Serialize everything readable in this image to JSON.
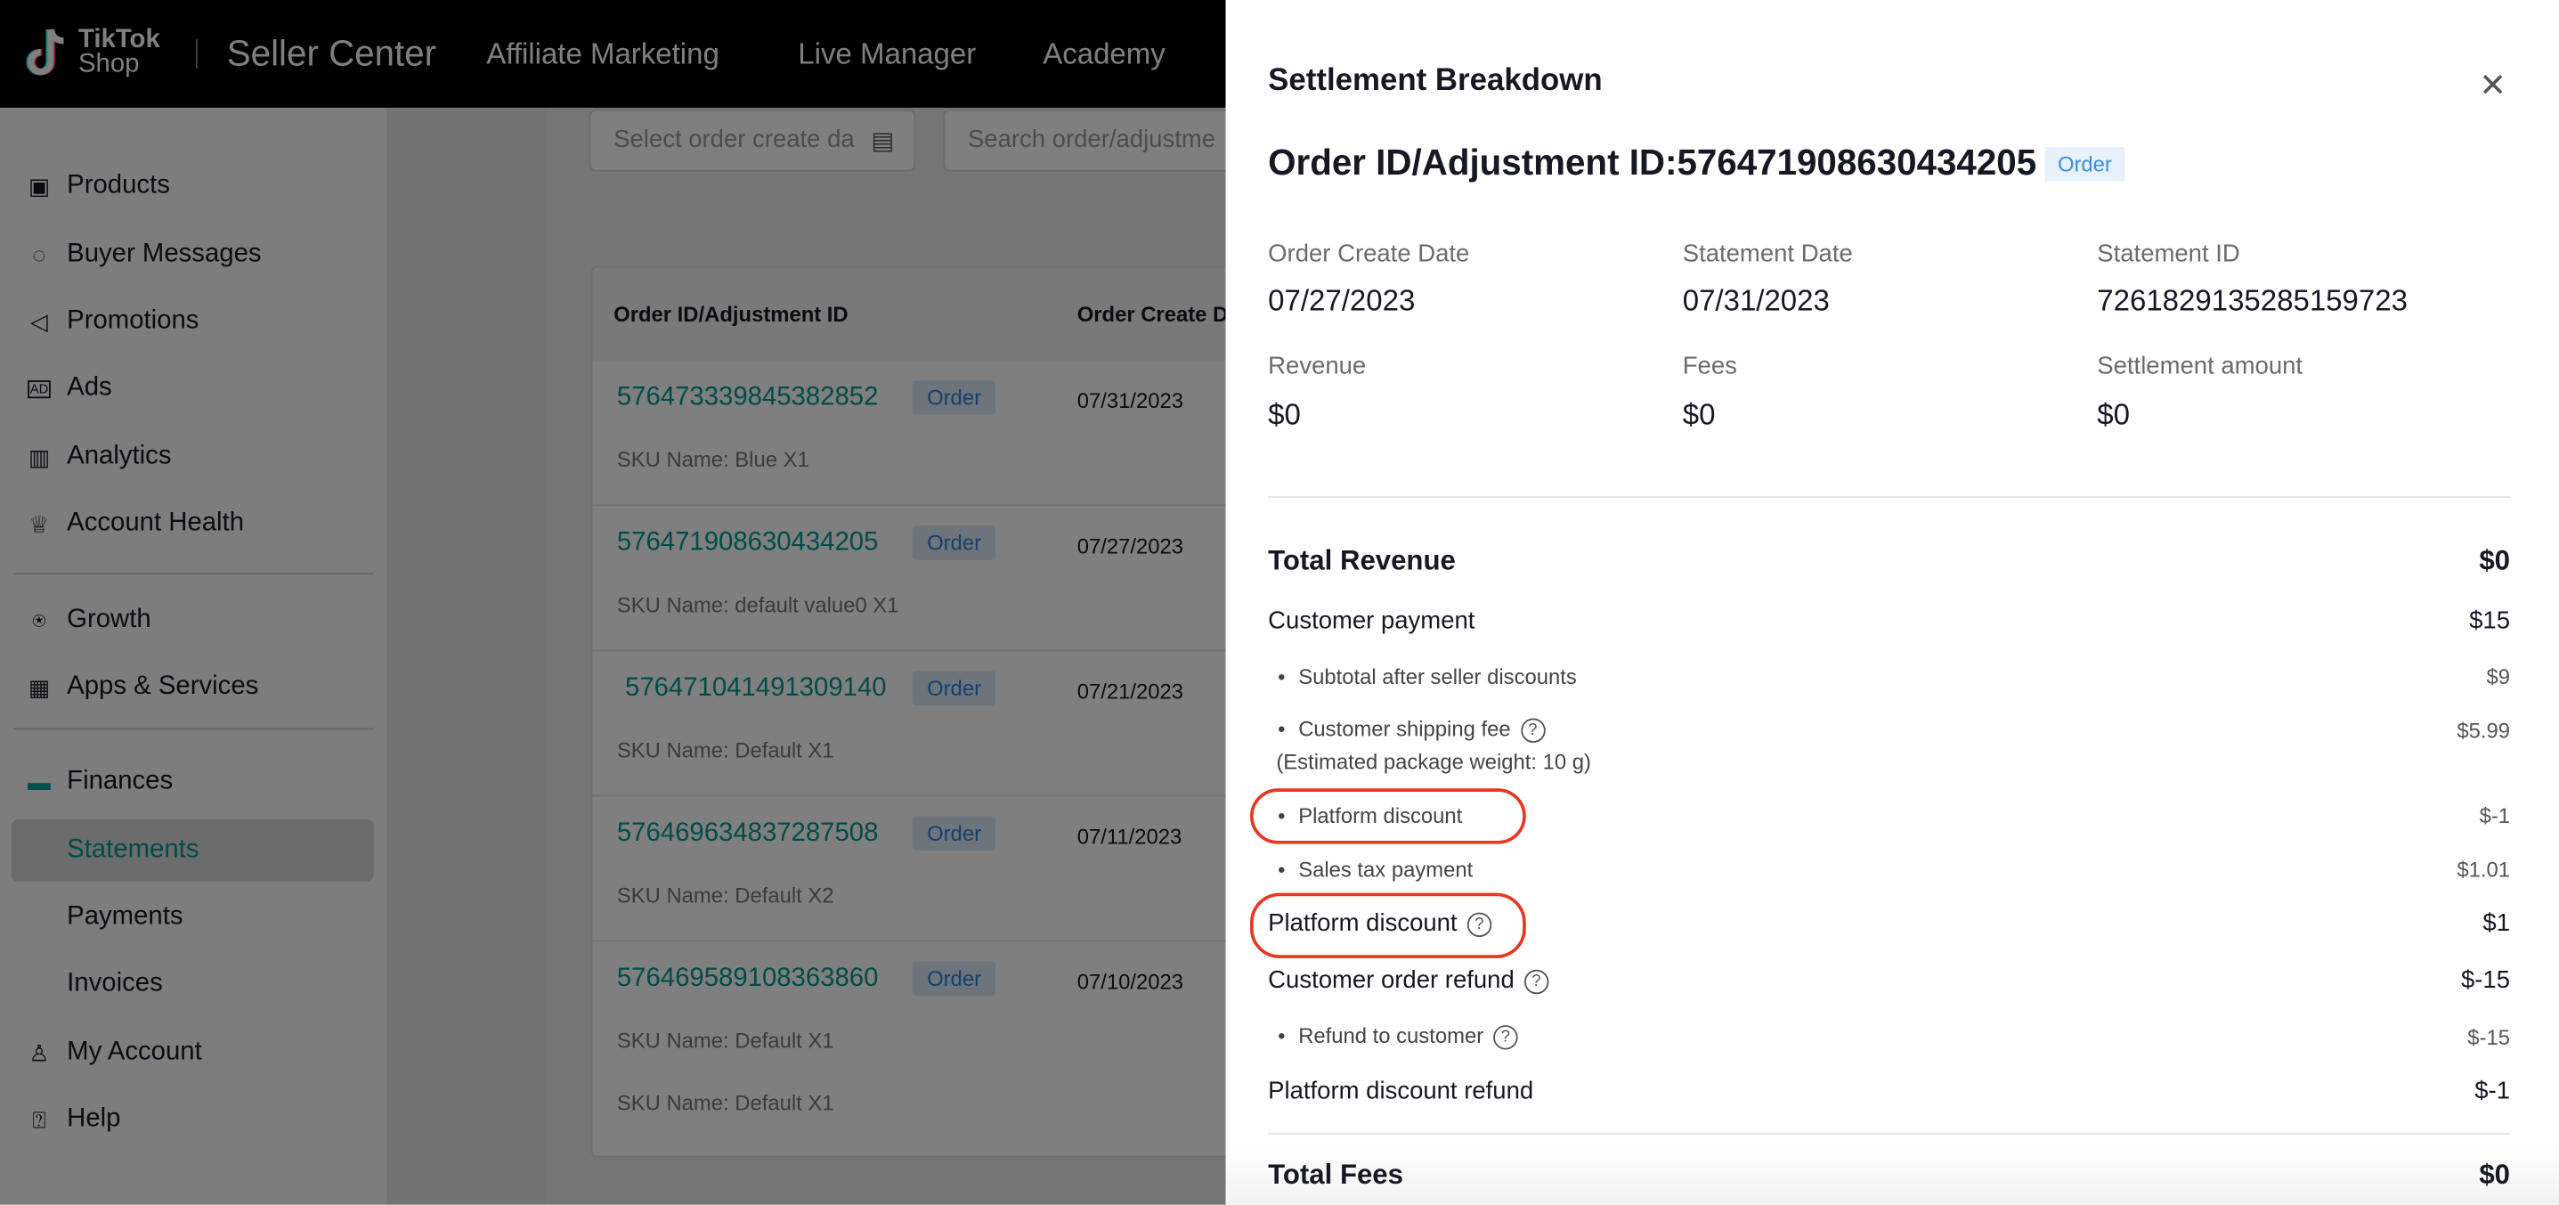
{
  "topbar": {
    "logo_line1": "TikTok",
    "logo_line2": "Shop",
    "title": "Seller Center",
    "nav": [
      "Affiliate Marketing",
      "Live Manager",
      "Academy"
    ]
  },
  "sidebar": {
    "items": [
      {
        "label": "Products",
        "icon": "products-icon"
      },
      {
        "label": "Buyer Messages",
        "icon": "chat-icon"
      },
      {
        "label": "Promotions",
        "icon": "megaphone-icon"
      },
      {
        "label": "Ads",
        "icon": "ads-icon"
      },
      {
        "label": "Analytics",
        "icon": "chart-icon"
      },
      {
        "label": "Account Health",
        "icon": "trophy-icon"
      },
      {
        "label": "Growth",
        "icon": "medal-icon"
      },
      {
        "label": "Apps & Services",
        "icon": "apps-icon"
      },
      {
        "label": "Finances",
        "icon": "wallet-icon"
      },
      {
        "label": "Statements",
        "active": true
      },
      {
        "label": "Payments"
      },
      {
        "label": "Invoices"
      },
      {
        "label": "My Account",
        "icon": "user-icon"
      },
      {
        "label": "Help",
        "icon": "help-icon"
      }
    ]
  },
  "filters": {
    "date_placeholder": "Select order create da",
    "search_placeholder": "Search order/adjustme"
  },
  "table": {
    "columns": [
      "Order ID/Adjustment ID",
      "Order Create D"
    ],
    "rows": [
      {
        "id": "576473339845382852",
        "badge": "Order",
        "date": "07/31/2023",
        "sku": [
          "SKU Name: Blue X1"
        ]
      },
      {
        "id": "576471908630434205",
        "badge": "Order",
        "date": "07/27/2023",
        "sku": [
          "SKU Name: default value0 X1"
        ]
      },
      {
        "id": "576471041491309140",
        "badge": "Order",
        "date": "07/21/2023",
        "sku": [
          "SKU Name: Default X1"
        ]
      },
      {
        "id": "576469634837287508",
        "badge": "Order",
        "date": "07/11/2023",
        "sku": [
          "SKU Name: Default X2"
        ]
      },
      {
        "id": "576469589108363860",
        "badge": "Order",
        "date": "07/10/2023",
        "sku": [
          "SKU Name: Default X1",
          "SKU Name: Default X1"
        ]
      }
    ]
  },
  "drawer": {
    "title": "Settlement Breakdown",
    "close": "✕",
    "order_label": "Order ID/Adjustment ID:576471908630434205",
    "badge": "Order",
    "summary": [
      {
        "label": "Order Create Date",
        "value": "07/27/2023"
      },
      {
        "label": "Statement Date",
        "value": "07/31/2023"
      },
      {
        "label": "Statement ID",
        "value": "7261829135285159723"
      },
      {
        "label": "Revenue",
        "value": "$0"
      },
      {
        "label": "Fees",
        "value": "$0"
      },
      {
        "label": "Settlement amount",
        "value": "$0"
      }
    ],
    "lines": [
      {
        "label": "Total Revenue",
        "amount": "$0",
        "level": 1
      },
      {
        "label": "Customer payment",
        "amount": "$15",
        "level": 2
      },
      {
        "label": "Subtotal after seller discounts",
        "amount": "$9",
        "level": 3
      },
      {
        "label": "Customer shipping fee",
        "amount": "$5.99",
        "level": 3,
        "help": true,
        "note": "(Estimated package weight: 10 g)"
      },
      {
        "label": "Platform discount",
        "amount": "$-1",
        "level": 3,
        "highlighted": true
      },
      {
        "label": "Sales tax payment",
        "amount": "$1.01",
        "level": 3
      },
      {
        "label": "Platform discount",
        "amount": "$1",
        "level": 2,
        "help": true,
        "highlighted": true
      },
      {
        "label": "Customer order refund",
        "amount": "$-15",
        "level": 2,
        "help": true
      },
      {
        "label": "Refund to customer",
        "amount": "$-15",
        "level": 3,
        "help": true
      },
      {
        "label": "Platform discount refund",
        "amount": "$-1",
        "level": 2
      },
      {
        "label": "Total Fees",
        "amount": "$0",
        "level": 1
      }
    ]
  },
  "colors": {
    "accent": "#009995",
    "badge_bg": "#e6f1fc",
    "badge_text": "#3a8ee6",
    "highlight_ring": "#e8371f"
  }
}
